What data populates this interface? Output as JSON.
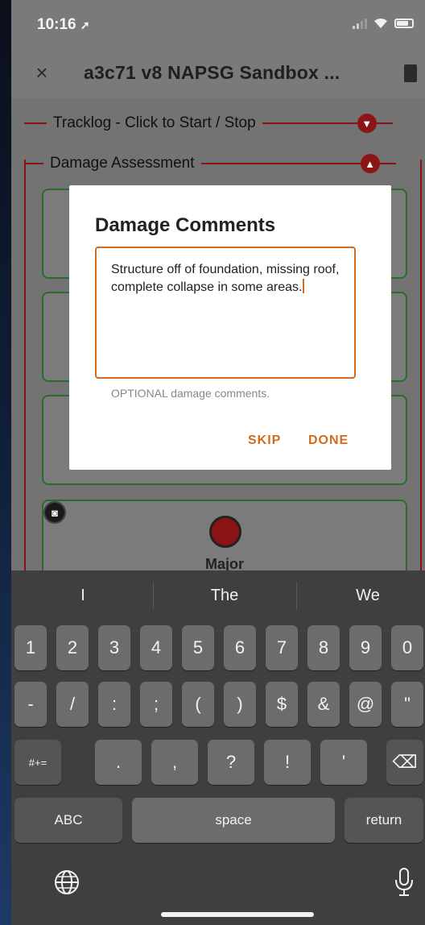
{
  "status_bar": {
    "time": "10:16"
  },
  "nav": {
    "title": "a3c71 v8 NAPSG Sandbox ...",
    "close_glyph": "×"
  },
  "form": {
    "sections": [
      {
        "label": "Tracklog - Click to Start / Stop",
        "state": "collapsed"
      },
      {
        "label": "Damage Assessment",
        "state": "expanded"
      }
    ],
    "severity_label": "Major"
  },
  "dialog": {
    "title": "Damage Comments",
    "value": "Structure off of foundation, missing roof, complete collapse in some areas.",
    "helper": "OPTIONAL damage comments.",
    "skip_label": "SKIP",
    "done_label": "DONE"
  },
  "keyboard": {
    "suggestions": [
      "I",
      "The",
      "We"
    ],
    "row1": [
      "1",
      "2",
      "3",
      "4",
      "5",
      "6",
      "7",
      "8",
      "9",
      "0"
    ],
    "row2": [
      "-",
      "/",
      ":",
      ";",
      "(",
      ")",
      "$",
      "&",
      "@",
      "\""
    ],
    "row3_mode": "#+=",
    "row3": [
      ".",
      ",",
      "?",
      "!",
      "'"
    ],
    "abc_label": "ABC",
    "space_label": "space",
    "return_label": "return"
  },
  "colors": {
    "accent": "#d36a1c",
    "section_red": "#8a1212",
    "card_green": "#2a6d2a"
  }
}
